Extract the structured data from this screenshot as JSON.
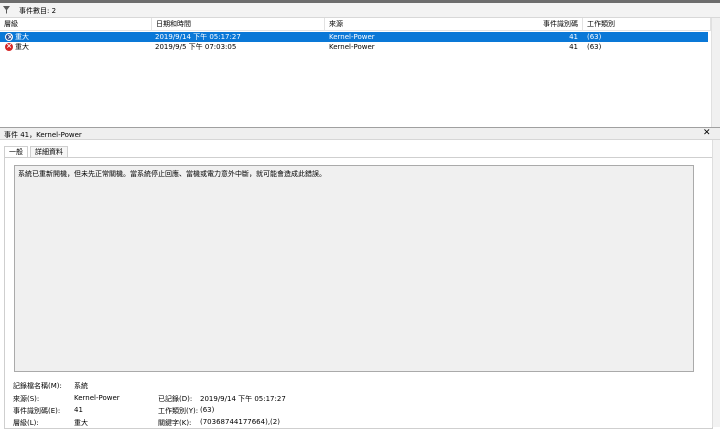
{
  "filter": {
    "label": "事件數目: 2"
  },
  "columns": {
    "level": "層級",
    "datetime": "日期和時間",
    "source": "來源",
    "event_id": "事件識別碼",
    "task": "工作類別"
  },
  "rows": [
    {
      "level": "重大",
      "datetime": "2019/9/14 下午 05:17:27",
      "source": "Kernel-Power",
      "event_id": "41",
      "task": "(63)",
      "selected": true
    },
    {
      "level": "重大",
      "datetime": "2019/9/5 下午 07:03:05",
      "source": "Kernel-Power",
      "event_id": "41",
      "task": "(63)",
      "selected": false
    }
  ],
  "detail": {
    "title": "事件 41，Kernel-Power",
    "close": "✕",
    "tabs": [
      "一般",
      "詳細資料"
    ],
    "description": "系統已重新開機，但未先正常關機。當系統停止回應、當機或電力意外中斷，就可能會造成此錯誤。",
    "props": {
      "log_name_label": "記錄檔名稱(M):",
      "log_name_value": "系統",
      "source_label": "來源(S):",
      "source_value": "Kernel-Power",
      "logged_label": "已記錄(D):",
      "logged_value": "2019/9/14 下午 05:17:27",
      "event_id_label": "事件識別碼(E):",
      "event_id_value": "41",
      "task_label": "工作類別(Y):",
      "task_value": "(63)",
      "level_label": "層級(L):",
      "level_value": "重大",
      "keywords_label": "關鍵字(K):",
      "keywords_value": "(70368744177664),(2)"
    }
  },
  "colors": {
    "selection": "#0a78d7",
    "error": "#d52525"
  },
  "icons": {
    "filter": "filter-icon",
    "error": "error-icon"
  }
}
